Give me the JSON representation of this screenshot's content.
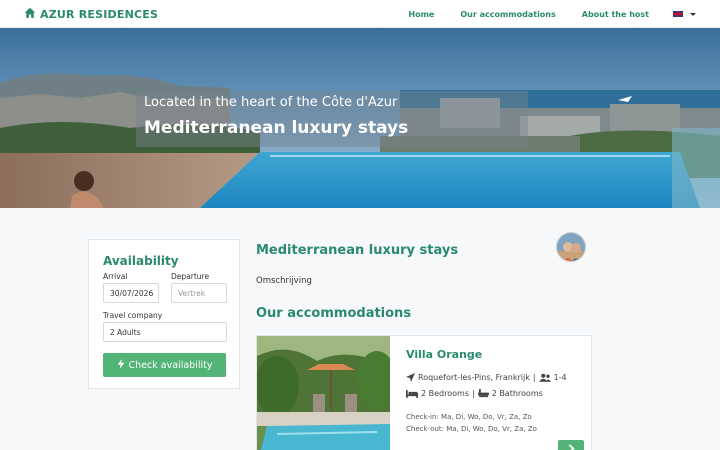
{
  "brand": {
    "name": "AZUR RESIDENCES",
    "icon": "home-icon"
  },
  "nav": {
    "items": [
      {
        "label": "Home"
      },
      {
        "label": "Our accommodations"
      },
      {
        "label": "About the host"
      }
    ],
    "language_flag": "uk-flag-icon"
  },
  "hero": {
    "subtitle": "Located in the heart of the Côte d'Azur",
    "title": "Mediterranean luxury stays"
  },
  "availability": {
    "title": "Availability",
    "arrival_label": "Arrival",
    "arrival_value": "30/07/2026",
    "departure_label": "Departure",
    "departure_placeholder": "Vertrek",
    "company_label": "Travel company",
    "company_value": "2 Adults",
    "button_label": "Check availability",
    "button_icon": "bolt-icon"
  },
  "main": {
    "title": "Mediterranean luxury stays",
    "description": "Omschrijving",
    "accommodations_heading": "Our accommodations"
  },
  "accommodations": [
    {
      "name": "Villa Orange",
      "location": "Roquefort-les-Pins, Frankrijk",
      "guests": "1-4",
      "bedrooms": "2 Bedrooms",
      "bathrooms": "2 Bathrooms",
      "checkin": "Check-in: Ma, Di, Wo, Do, Vr, Za, Zo",
      "checkout": "Check-out: Ma, Di, Wo, Do, Vr, Za, Zo",
      "button_icon": "chevron-right-icon"
    }
  ],
  "colors": {
    "accent": "#2a8a6e",
    "button": "#52b477"
  }
}
